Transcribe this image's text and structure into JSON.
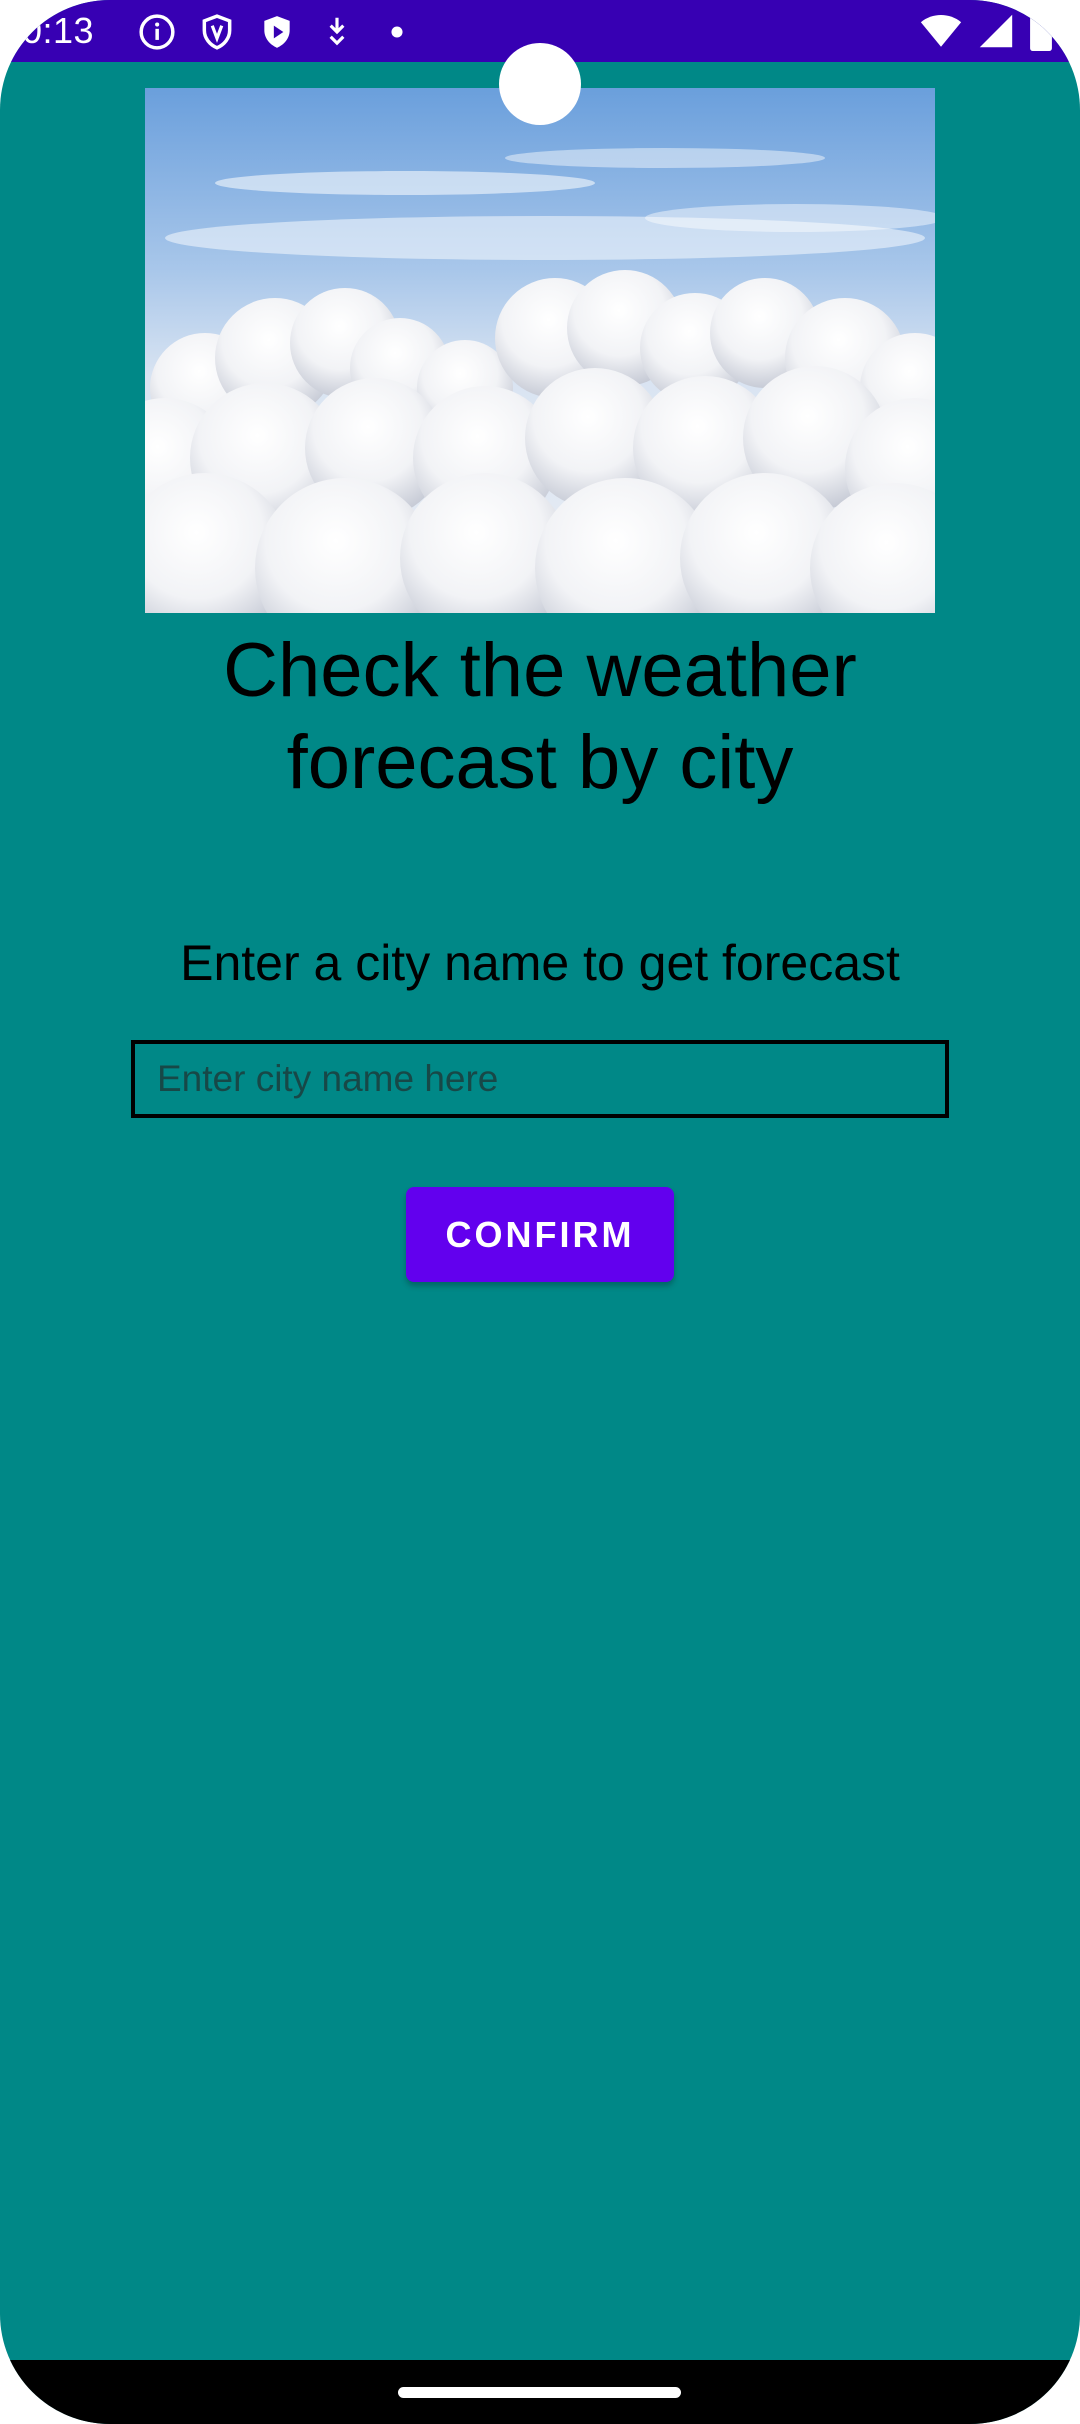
{
  "status_bar": {
    "time": "0:13",
    "left_icons": [
      "info-icon",
      "shield-icon",
      "play-shield-icon",
      "download-icon",
      "dot-icon"
    ],
    "right_icons": [
      "wifi-icon",
      "cell-signal-icon",
      "battery-icon"
    ],
    "background": "#3700b3"
  },
  "main": {
    "background": "#008887",
    "headline": "Check the weather forecast by city",
    "prompt": "Enter a city name to get forecast",
    "city_input": {
      "value": "",
      "placeholder": "Enter city name here"
    },
    "confirm_label": "CONFIRM",
    "accent": "#6200ee"
  }
}
